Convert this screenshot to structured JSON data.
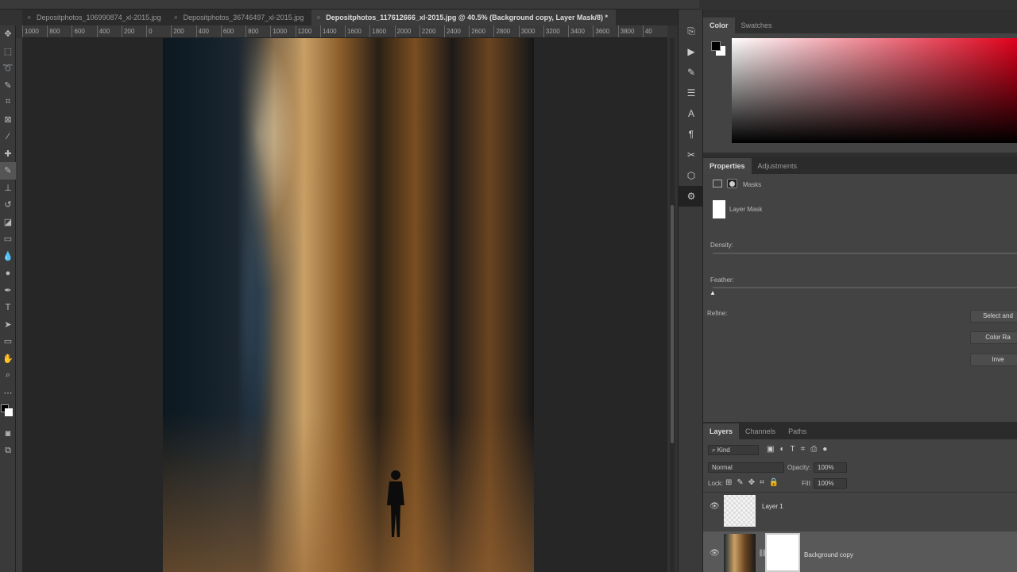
{
  "tabs": [
    {
      "label": "Depositphotos_106990874_xl-2015.jpg",
      "active": false
    },
    {
      "label": "Depositphotos_36746497_xl-2015.jpg",
      "active": false
    },
    {
      "label": "Depositphotos_117612666_xl-2015.jpg @ 40.5% (Background copy, Layer Mask/8) *",
      "active": true
    }
  ],
  "close_glyph": "×",
  "ruler": [
    "1000",
    "800",
    "600",
    "400",
    "200",
    "0",
    "200",
    "400",
    "600",
    "800",
    "1000",
    "1200",
    "1400",
    "1600",
    "1800",
    "2000",
    "2200",
    "2400",
    "2600",
    "2800",
    "3000",
    "3200",
    "3400",
    "3600",
    "3800",
    "40"
  ],
  "color_panel": {
    "tabs": [
      "Color",
      "Swatches"
    ],
    "foreground": "#000000",
    "background": "#ffffff",
    "hue": "#e0001a"
  },
  "properties": {
    "tabs": [
      "Properties",
      "Adjustments"
    ],
    "masks_label": "Masks",
    "layer_mask_label": "Layer Mask",
    "density_label": "Density:",
    "feather_label": "Feather:",
    "refine_label": "Refine:",
    "buttons": [
      "Select and",
      "Color Ra",
      "Inve"
    ]
  },
  "layers": {
    "tabs": [
      "Layers",
      "Channels",
      "Paths"
    ],
    "filter_kind": "Kind",
    "blend_mode": "Normal",
    "opacity_label": "Opacity:",
    "opacity": "100%",
    "lock_label": "Lock:",
    "fill_label": "Fill:",
    "fill": "100%",
    "items": [
      {
        "name": "Layer 1",
        "visible": true
      },
      {
        "name": "Background copy",
        "visible": true,
        "selected": true
      }
    ]
  }
}
